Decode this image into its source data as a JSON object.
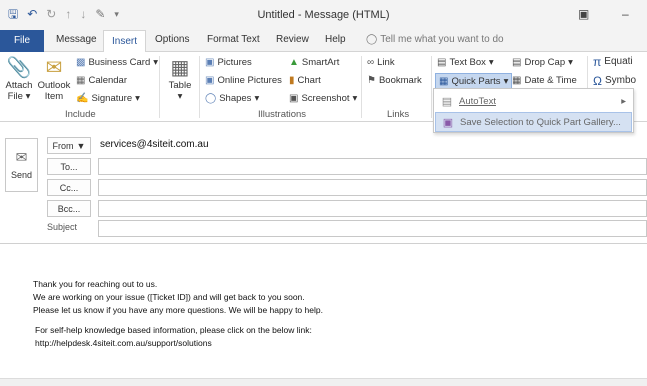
{
  "titlebar": {
    "title": "Untitled  -  Message (HTML)",
    "qat_icons": [
      "save-icon",
      "undo-icon",
      "redo-icon",
      "up-arrow-icon",
      "down-arrow-icon",
      "paint-icon",
      "customize-icon"
    ]
  },
  "tabs": [
    "File",
    "Message",
    "Insert",
    "Options",
    "Format Text",
    "Review",
    "Help"
  ],
  "active_tab": "Insert",
  "tell_me": "Tell me what you want to do",
  "ribbon": {
    "include": {
      "attach": "Attach",
      "attach2": "File",
      "outlook": "Outlook",
      "outlook2": "Item",
      "business_card": "Business Card",
      "calendar": "Calendar",
      "signature": "Signature",
      "label": "Include"
    },
    "tables": {
      "table": "Table"
    },
    "illustrations": {
      "pictures": "Pictures",
      "online_pictures": "Online Pictures",
      "shapes": "Shapes",
      "smartart": "SmartArt",
      "chart": "Chart",
      "screenshot": "Screenshot",
      "label": "Illustrations"
    },
    "links": {
      "link": "Link",
      "bookmark": "Bookmark",
      "label": "Links"
    },
    "text": {
      "text_box": "Text Box",
      "quick_parts": "Quick Parts",
      "drop_cap": "Drop Cap",
      "date_time": "Date & Time",
      "equation": "Equati",
      "symbol": "Symbo"
    }
  },
  "quick_parts_menu": {
    "autotext": "AutoText",
    "save_selection": "Save Selection to Quick Part Gallery..."
  },
  "compose": {
    "send": "Send",
    "from": "From",
    "from_value": "services@4siteit.com.au",
    "to": "To...",
    "cc": "Cc...",
    "bcc": "Bcc...",
    "subject": "Subject"
  },
  "body": {
    "line1": "Thank you for reaching out to us.",
    "line2": "We are working on your issue ([Ticket ID]) and will get back to you soon.",
    "line3": "Please let us know if you have any more questions. We will be happy to help.",
    "line4": "For self-help knowledge based information, please click on the below link:",
    "line5": "http://helpdesk.4siteit.com.au/support/solutions"
  }
}
